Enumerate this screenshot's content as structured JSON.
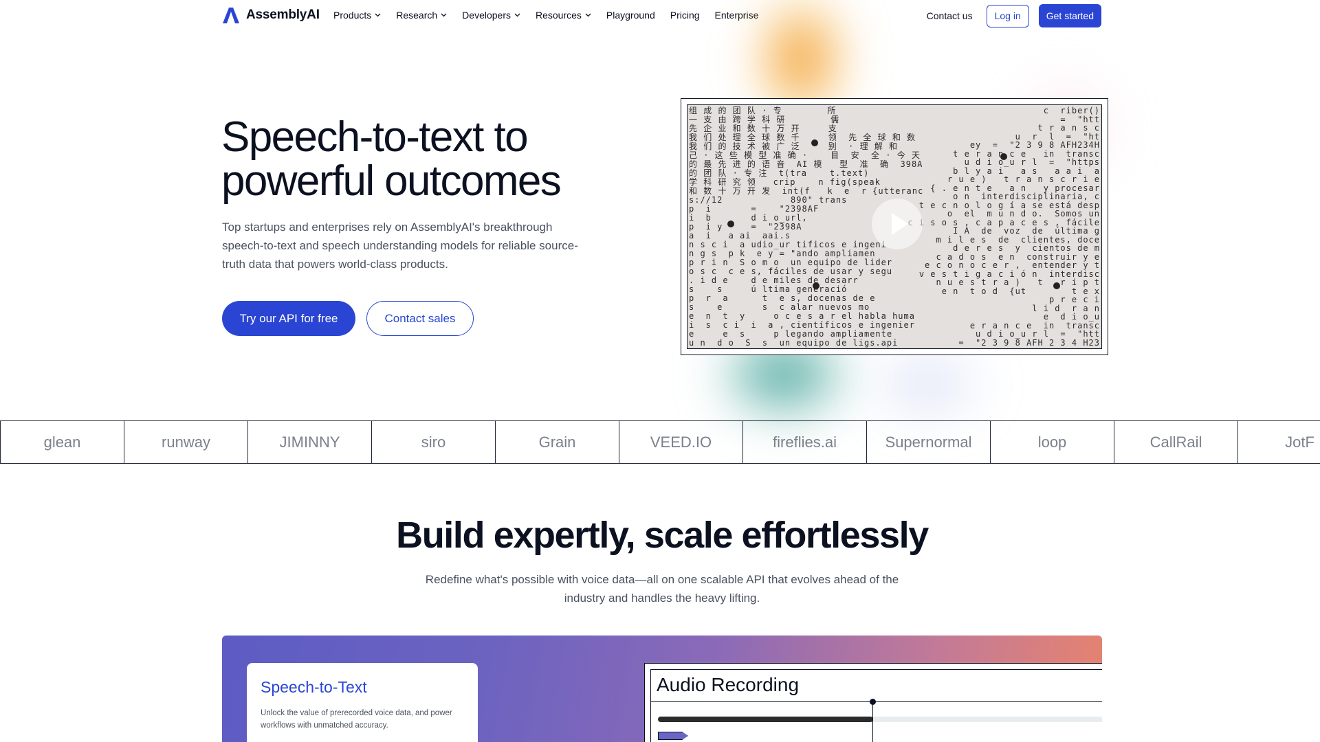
{
  "brand": {
    "name": "AssemblyAI",
    "accent": "#2a45d3"
  },
  "nav": {
    "items": [
      {
        "label": "Products",
        "has_dropdown": true
      },
      {
        "label": "Research",
        "has_dropdown": true
      },
      {
        "label": "Developers",
        "has_dropdown": true
      },
      {
        "label": "Resources",
        "has_dropdown": true
      },
      {
        "label": "Playground",
        "has_dropdown": false
      },
      {
        "label": "Pricing",
        "has_dropdown": false
      },
      {
        "label": "Enterprise",
        "has_dropdown": false
      }
    ],
    "contact": "Contact us",
    "login": "Log in",
    "get_started": "Get started"
  },
  "hero": {
    "title": "Speech-to-text to powerful outcomes",
    "subtitle": "Top startups and enterprises rely on AssemblyAI's breakthrough speech-to-text and speech understanding models for reliable source-truth data that powers world-class products.",
    "cta_primary": "Try our API for free",
    "cta_secondary": "Contact sales"
  },
  "hero_video": {
    "lines_left": [
      "组 成 的 团 队 · 专        所",
      "一 支 由 跨 学 科 研        儒",
      "先 企 业 和 数 十 万 开     支",
      "我 们 处 理 全 球 数 千     领  先 全 球 和 数",
      "我 们 的 技 术 被 广 泛     别  · 理 解 和",
      "己 · 这 些 模 型 准 确 ·    目  安  全 · 今 天",
      "的 最 先 进 的 语 音  AI 模   型  准  确  398A",
      "的 团 队 · 专 注  t(tra    t.text)",
      "学 科 研 究 领   crip    n fig(speak",
      "和 数 十 万 开 发  int(f   k  e  r {utteranc",
      "s://12            890\" trans",
      "p  i       =    \"2398AF",
      "i  b       d i o_url,",
      "p  i y     =  \"2398A",
      "a  i   a ai  aai.s",
      "n s c i  a udio_ur tificos e ingeni",
      "n g s  p k  e y = \"ando ampliamen",
      "p r i n  S o m o  un equipo de lider",
      "o s c  c e s, fáciles de usar y segu",
      ". i d e    d e miles de desarr",
      "s    s     ú ltima generació",
      "p  r  a      t  e s, docenas de e",
      "s    e       s  c alar nuevos mo",
      "e  n  t  y     o c e s a r el habla huma",
      "i  s  c i  i  a , científicos e ingenier",
      "e     e  s     p legando ampliamente",
      "u n  d o  S  s  un equipo de ligs.api"
    ],
    "lines_right": [
      "c  riber()",
      "=  \"htt",
      "t r a n s c",
      "u  r  l  =  \"ht",
      "ey  =  \"2 3 9 8 AFH234H",
      "t e r a n c e   in  transc",
      "u d i o_u r l  =  \"https",
      "b l y a i   a s   a a i  a",
      "r u e )   t r a n s c r i e",
      "{ . e n t e   a n   y procesar",
      "o n  interdisciplinaria, c",
      "t e c n o l o g í a se está desp",
      "o  el  m u n d o.  Somos un",
      "c i s o s , c a p a c e s , fácile",
      "I A  de  voz  de  última g",
      "m i l e s  de  clientes, doce",
      "d e r e s  y  cientos de m",
      "c a d o s  e n  construir y e",
      "e c o n o c e r ,  entender y t",
      "v e s t i g a c i ó n  interdisc",
      "n u e s t r a )   t   r i p t",
      "e n  t o d  {ut        t e x",
      "p r e c i",
      "l i d  r a n",
      "e  d i o_u",
      "e r a n c e  in  transc",
      "u d i o_u r l  =  \"htt",
      "=  \"2 3 9 8 AFH 2 3 4 H23"
    ]
  },
  "logos": [
    "glean",
    "runway",
    "JIMINNY",
    "siro",
    "Grain",
    "VEED.IO",
    "fireflies.ai",
    "Supernormal",
    "loop",
    "CallRail",
    "JotF"
  ],
  "section": {
    "title": "Build expertly, scale effortlessly",
    "subtitle": "Redefine what's possible with voice data—all on one scalable API that evolves ahead of the industry and handles the heavy lifting."
  },
  "feature": {
    "card_title": "Speech-to-Text",
    "card_desc": "Unlock the value of prerecorded voice data, and power workflows with unmatched accuracy.",
    "audio_title": "Audio Recording",
    "playback_progress": 0.49
  }
}
